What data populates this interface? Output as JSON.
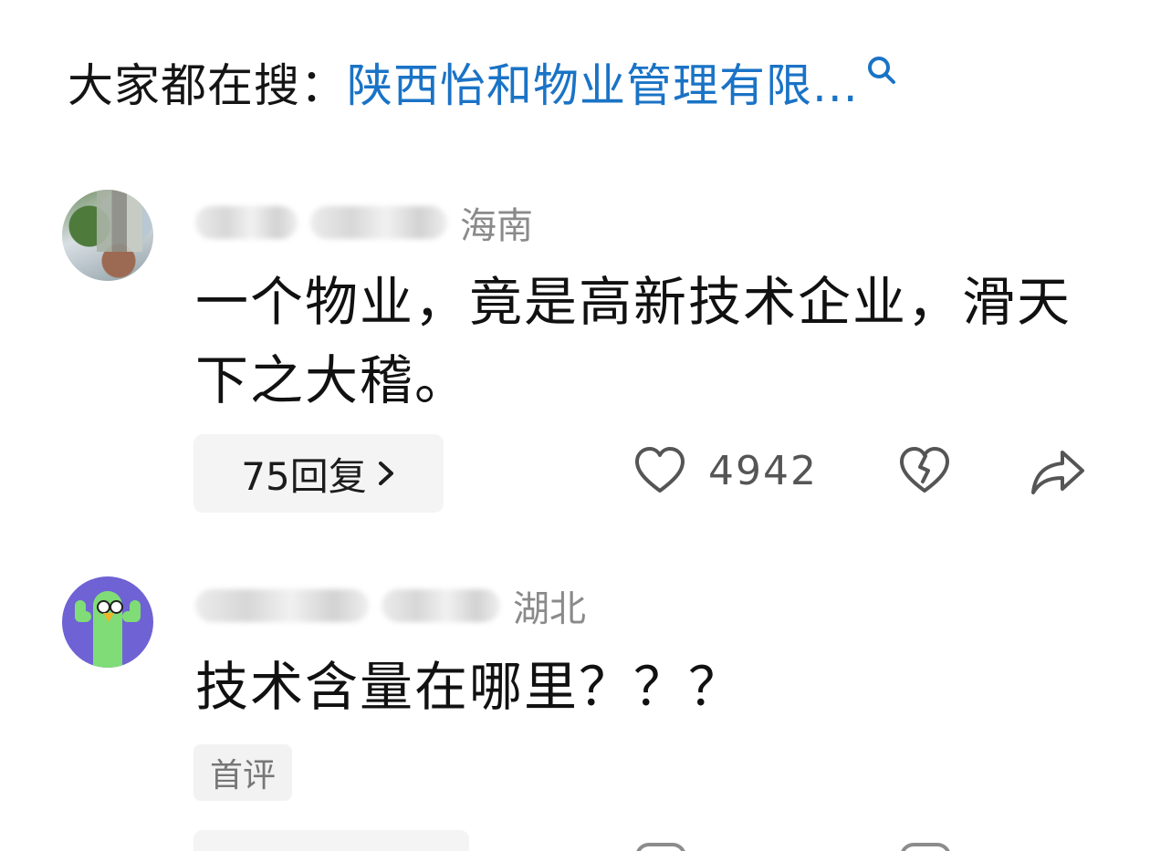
{
  "search_bar": {
    "prefix": "大家都在搜：",
    "query": "陕西怡和物业管理有限...",
    "icon": "search-icon",
    "accent_color": "#1a73c6"
  },
  "comments": [
    {
      "avatar": "avatar-photo",
      "region": "海南",
      "text": "一个物业，竟是高新技术企业，滑天下之大稽。",
      "reply_label": "75回复",
      "like_count": "4942",
      "icons": [
        "heart-icon",
        "broken-heart-icon",
        "share-icon"
      ]
    },
    {
      "avatar": "avatar-cactus",
      "region": "湖北",
      "text": "技术含量在哪里？？？",
      "tag": "首评",
      "icons": [
        "heart-icon",
        "broken-heart-icon",
        "share-icon"
      ]
    }
  ]
}
